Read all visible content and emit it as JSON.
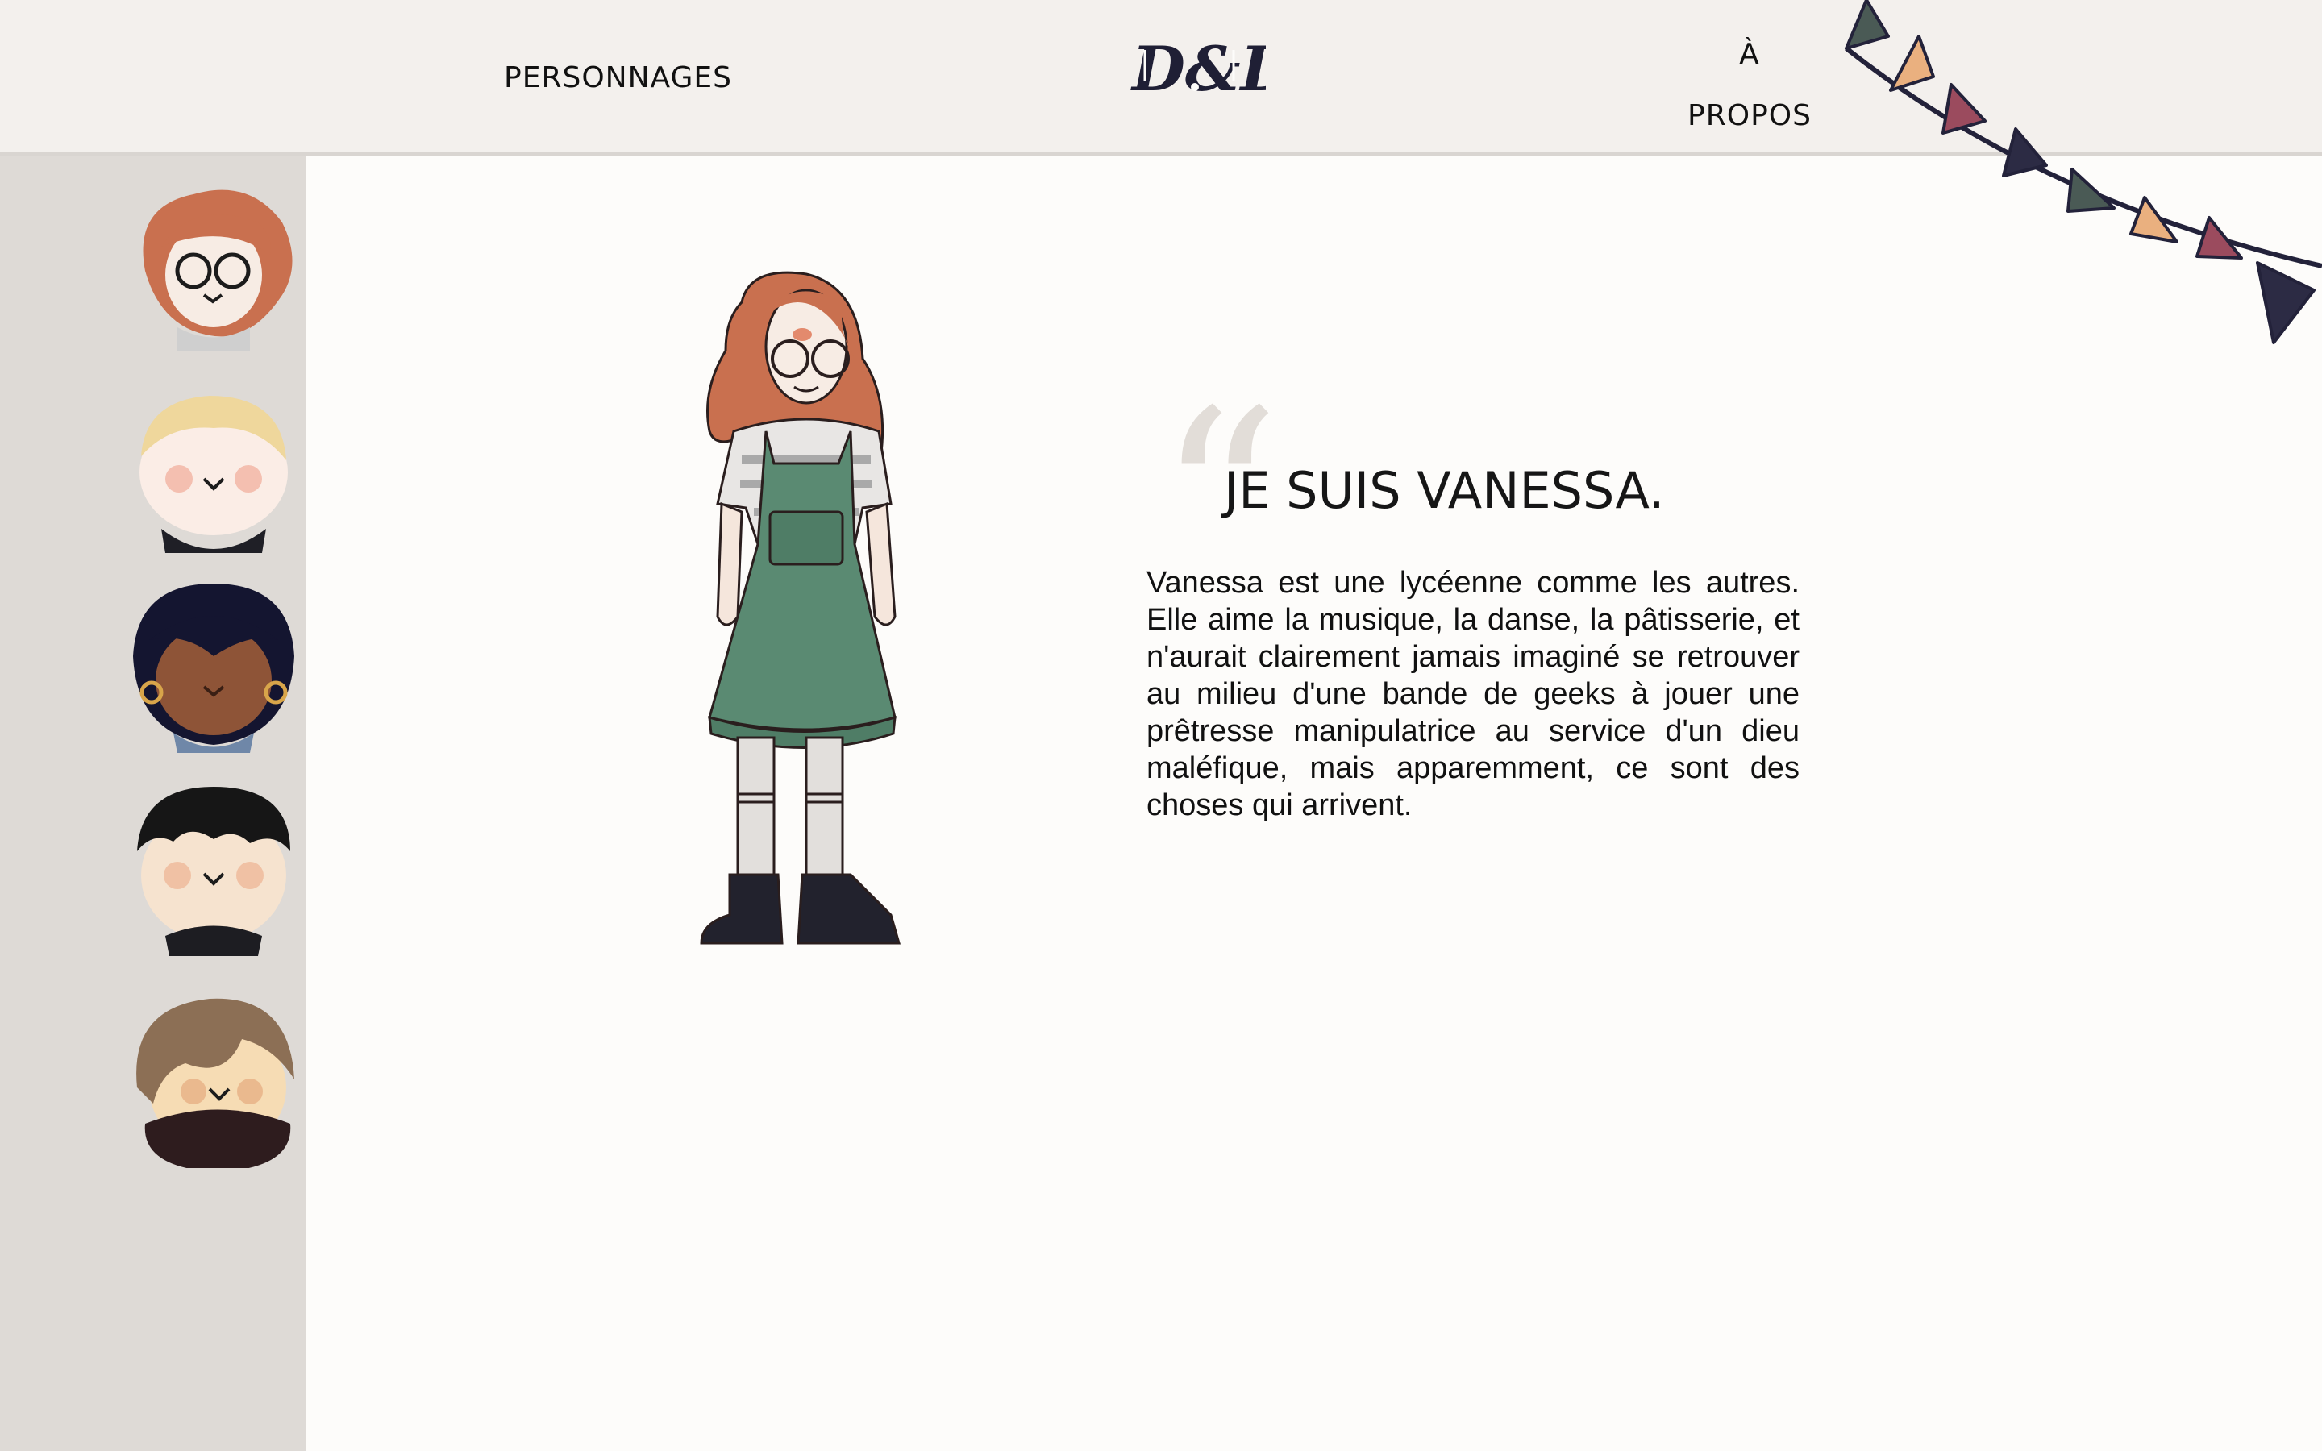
{
  "header": {
    "nav_personnages": "PERSONNAGES",
    "logo_text": "D&D",
    "nav_apropos_line1": "À",
    "nav_apropos_line2": "PROPOS"
  },
  "sidebar": {
    "avatars": [
      {
        "hair": "#c9704f",
        "skin": "#f7ece4",
        "glasses": true
      },
      {
        "hair": "#efd79c",
        "skin": "#fbede6",
        "glasses": false
      },
      {
        "hair": "#141530",
        "skin": "#8e5437",
        "glasses": false
      },
      {
        "hair": "#161616",
        "skin": "#f6e3cf",
        "glasses": false
      },
      {
        "hair": "#8c6f55",
        "skin": "#f6dcb4",
        "glasses": false
      }
    ]
  },
  "main": {
    "quote_mark": "“",
    "title": "JE SUIS VANESSA.",
    "description": "Vanessa est une lycéenne comme les autres. Elle aime la musique, la danse, la pâtisserie, et n'aurait clairement jamais imaginé se retrouver au milieu d'une bande de geeks à jouer une prêtresse manipulatrice au service d'un dieu maléfique, mais apparemment, ce sont des choses qui arrivent."
  },
  "colors": {
    "header_bg": "#f3f0ed",
    "sidebar_bg": "#dedad6",
    "page_bg": "#fdfcfa",
    "bunting": [
      "#4a5a55",
      "#eab07f",
      "#9b4b5e",
      "#2c2b44"
    ],
    "dress_green": "#5a8a72"
  },
  "icons": [
    "bunting-flags",
    "dnd-logo",
    "character-illustration"
  ]
}
